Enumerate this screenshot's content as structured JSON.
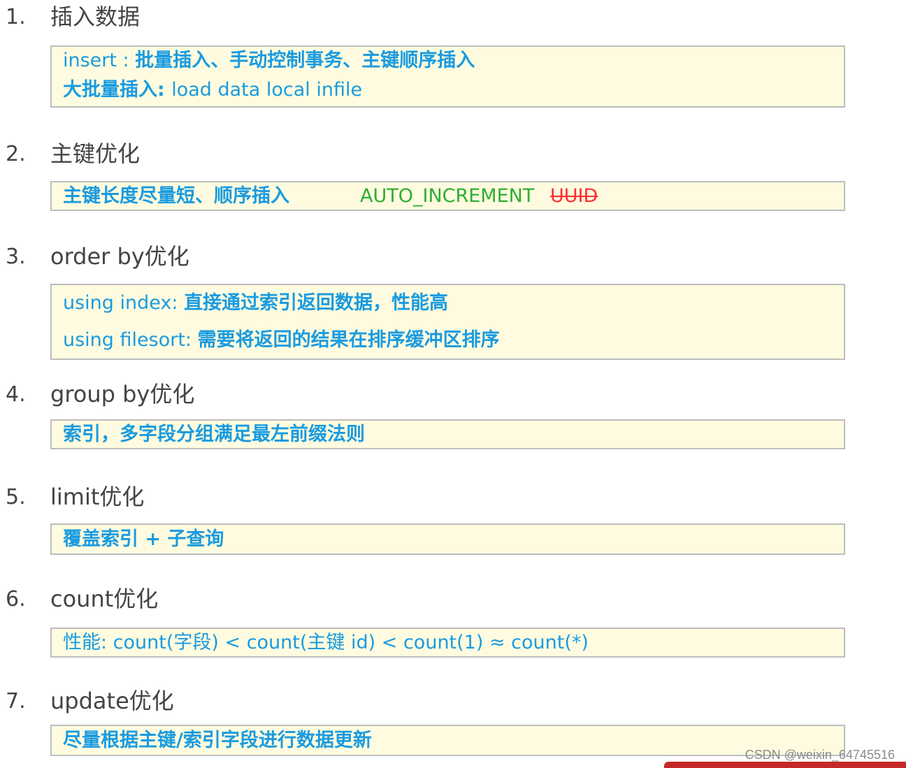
{
  "items": [
    {
      "num": "1.",
      "title": "插入数据",
      "lines": [
        {
          "code": "insert : ",
          "text": "批量插入、手动控制事务、主键顺序插入"
        },
        {
          "code": "大批量插入: ",
          "text": "load  data  local  infile"
        }
      ]
    },
    {
      "num": "2.",
      "title": "主键优化",
      "lines": [
        {
          "text": "主键长度尽量短、顺序插入",
          "green": "AUTO_INCREMENT",
          "strike": "UUID"
        }
      ]
    },
    {
      "num": "3.",
      "title": "order by优化",
      "lines": [
        {
          "code": "using index: ",
          "text": "直接通过索引返回数据，性能高"
        },
        {
          "code": "using filesort: ",
          "text": "需要将返回的结果在排序缓冲区排序"
        }
      ]
    },
    {
      "num": "4.",
      "title": "group by优化",
      "lines": [
        {
          "text": "索引，多字段分组满足最左前缀法则"
        }
      ]
    },
    {
      "num": "5.",
      "title": "limit优化",
      "lines": [
        {
          "text": "覆盖索引 + 子查询"
        }
      ]
    },
    {
      "num": "6.",
      "title": "count优化",
      "lines": [
        {
          "text": "性能: count(字段) < count(主键 id) < count(1) ≈ count(*)"
        }
      ]
    },
    {
      "num": "7.",
      "title": "update优化",
      "lines": [
        {
          "text": "尽量根据主键/索引字段进行数据更新"
        }
      ]
    }
  ],
  "watermark": "CSDN @weixin_64745516"
}
